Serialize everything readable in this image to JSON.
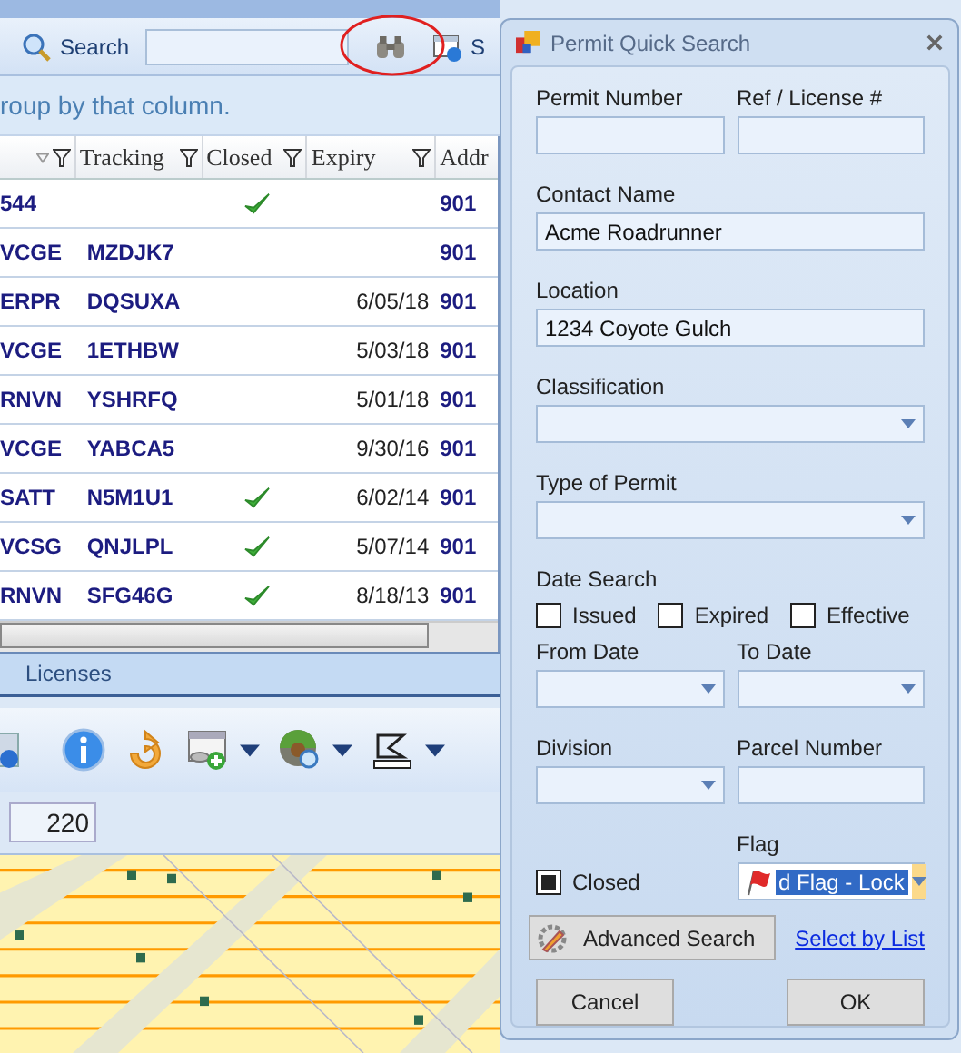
{
  "toolbar": {
    "search_label": "Search",
    "cut_label": "S"
  },
  "group_hint": "roup by that column.",
  "grid": {
    "columns": [
      {
        "kind": "code"
      },
      {
        "kind": "text",
        "label": "Tracking"
      },
      {
        "kind": "check",
        "label": "Closed"
      },
      {
        "kind": "date",
        "label": "Expiry"
      },
      {
        "kind": "text",
        "label": "Addr"
      }
    ],
    "rows": [
      {
        "code": "544",
        "closed": true,
        "address": "901"
      },
      {
        "code": "VCGE",
        "tracking": "MZDJK7",
        "closed": false,
        "address": "901"
      },
      {
        "code": "ERPR",
        "tracking": "DQSUXA",
        "closed": false,
        "expiry": "6/05/18",
        "address": "901"
      },
      {
        "code": "VCGE",
        "tracking": "1ETHBW",
        "closed": false,
        "expiry": "5/03/18",
        "address": "901"
      },
      {
        "code": "RNVN",
        "tracking": "YSHRFQ",
        "closed": false,
        "expiry": "5/01/18",
        "address": "901"
      },
      {
        "code": "VCGE",
        "tracking": "YABCA5",
        "closed": false,
        "expiry": "9/30/16",
        "address": "901"
      },
      {
        "code": "SATT",
        "tracking": "N5M1U1",
        "closed": true,
        "expiry": "6/02/14",
        "address": "901"
      },
      {
        "code": "VCSG",
        "tracking": "QNJLPL",
        "closed": true,
        "expiry": "5/07/14",
        "address": "901"
      },
      {
        "code": "RNVN",
        "tracking": "SFG46G",
        "closed": true,
        "expiry": "8/18/13",
        "address": "901"
      }
    ]
  },
  "bottom_tab": "Licenses",
  "scale_value": "220",
  "dialog": {
    "title": "Permit Quick Search",
    "rows_top": [
      [
        {
          "label": "Permit Number",
          "kind": "text"
        },
        {
          "label": "Ref / License #",
          "kind": "text"
        }
      ],
      [
        {
          "label": "Contact Name",
          "kind": "text",
          "value": "Acme Roadrunner"
        }
      ],
      [
        {
          "label": "Location",
          "kind": "text",
          "value": "1234 Coyote Gulch"
        }
      ],
      [
        {
          "label": "Classification",
          "kind": "dropdown"
        }
      ],
      [
        {
          "label": "Type of Permit",
          "kind": "dropdown"
        }
      ]
    ],
    "date_search": {
      "label": "Date Search",
      "options": [
        {
          "label": "Issued",
          "checked": false
        },
        {
          "label": "Expired",
          "checked": false
        },
        {
          "label": "Effective",
          "checked": false
        }
      ]
    },
    "rows_bottom": [
      [
        {
          "label": "From Date",
          "kind": "dropdown"
        },
        {
          "label": "To Date",
          "kind": "dropdown"
        }
      ],
      [
        {
          "label": "Division",
          "kind": "dropdown"
        },
        {
          "label": "Parcel Number",
          "kind": "text"
        }
      ]
    ],
    "closed": {
      "label": "Closed",
      "checked": true
    },
    "flag": {
      "label": "Flag",
      "value": "d Flag - Lock"
    },
    "advanced_button": "Advanced Search",
    "link": "Select by List",
    "buttons": [
      "Cancel",
      "OK"
    ]
  }
}
